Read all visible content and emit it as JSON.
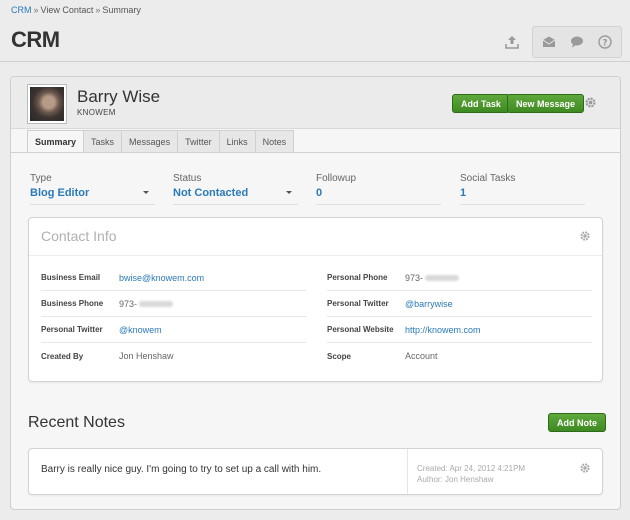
{
  "breadcrumb": {
    "root": "CRM",
    "separator": "»",
    "items": [
      "View Contact",
      "Summary"
    ]
  },
  "app": {
    "title": "CRM"
  },
  "contact": {
    "name": "Barry Wise",
    "company": "KNOWEM",
    "buttons": {
      "add_task": "Add Task",
      "new_message": "New Message"
    }
  },
  "tabs": [
    "Summary",
    "Tasks",
    "Messages",
    "Twitter",
    "Links",
    "Notes"
  ],
  "summary": {
    "type": {
      "label": "Type",
      "value": "Blog Editor"
    },
    "status": {
      "label": "Status",
      "value": "Not Contacted"
    },
    "followup": {
      "label": "Followup",
      "value": "0"
    },
    "social_tasks": {
      "label": "Social Tasks",
      "value": "1"
    }
  },
  "contact_info": {
    "title": "Contact Info",
    "left": [
      {
        "label": "Business Email",
        "value": "bwise@knowem.com"
      },
      {
        "label": "Business Phone",
        "value": "973-"
      },
      {
        "label": "Personal Twitter",
        "value": "@knowem"
      },
      {
        "label": "Created By",
        "value": "Jon Henshaw"
      }
    ],
    "right": [
      {
        "label": "Personal Phone",
        "value": "973-"
      },
      {
        "label": "Personal Twitter",
        "value": "@barrywise"
      },
      {
        "label": "Personal Website",
        "value": "http://knowem.com"
      },
      {
        "label": "Scope",
        "value": "Account"
      }
    ]
  },
  "recent_notes": {
    "title": "Recent Notes",
    "add_label": "Add Note",
    "notes": [
      {
        "text": "Barry is really nice guy. I'm going to try to set up a call with him.",
        "created": "Created: Apr 24, 2012 4:21PM",
        "author": "Author: Jon Henshaw"
      }
    ]
  },
  "colors": {
    "link": "#2a7ab8",
    "button_green": "#4a9a2c"
  }
}
